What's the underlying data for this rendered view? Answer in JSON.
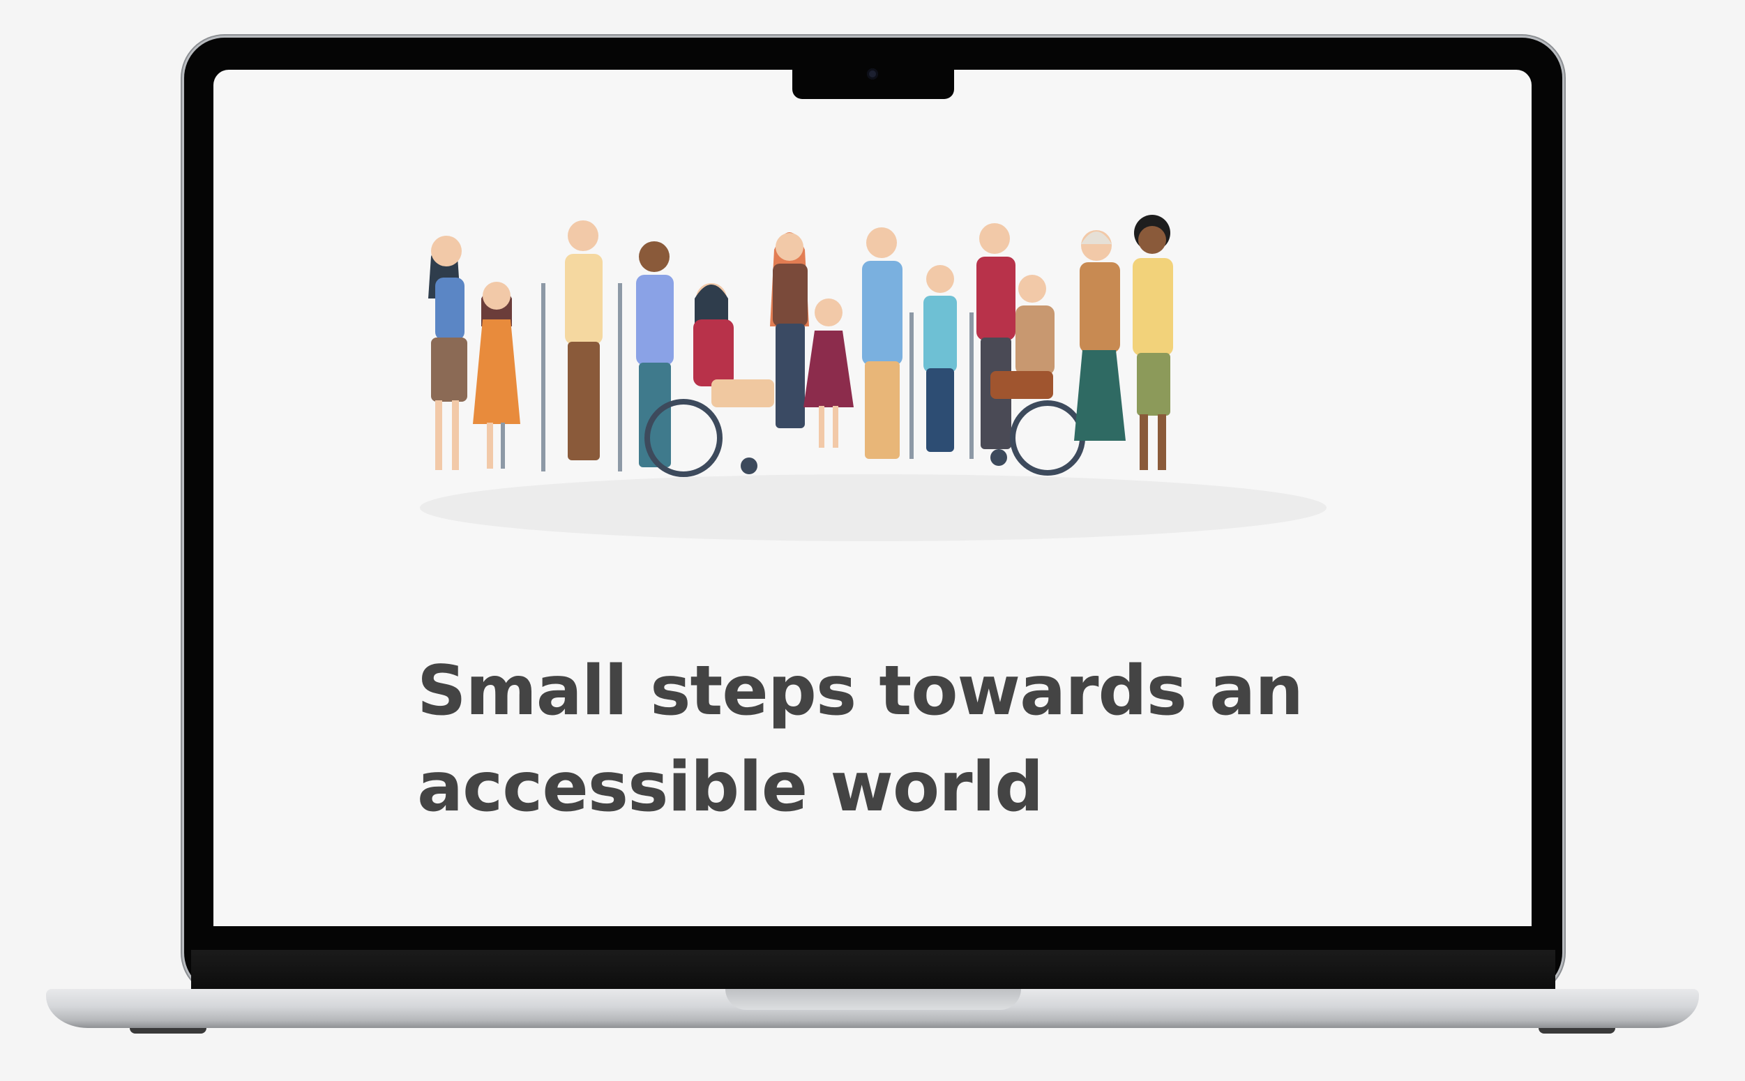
{
  "screen": {
    "headline_line1": "Small steps towards an",
    "headline_line2": "accessible world"
  },
  "illustration": {
    "subject": "diverse-group-of-people-with-disabilities",
    "colors": {
      "ground": "#ececec",
      "skin_light": "#f2c9a8",
      "skin_dark": "#8a5a3a",
      "headline": "#444444"
    }
  }
}
